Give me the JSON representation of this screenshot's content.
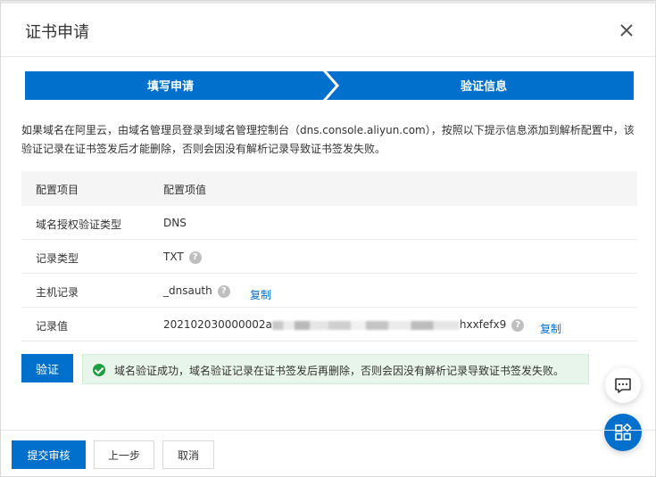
{
  "dialog": {
    "title": "证书申请"
  },
  "steps": [
    {
      "label": "填写申请"
    },
    {
      "label": "验证信息"
    }
  ],
  "info": {
    "text": "如果域名在阿里云，由域名管理员登录到域名管理控制台（dns.console.aliyun.com），按照以下提示信息添加到解析配置中，该验证记录在证书签发后才能删除，否则会因没有解析记录导致证书签发失败。"
  },
  "table": {
    "headers": {
      "key": "配置项目",
      "value": "配置项值"
    },
    "rows": [
      {
        "key": "域名授权验证类型",
        "value": "DNS"
      },
      {
        "key": "记录类型",
        "value": "TXT"
      },
      {
        "key": "主机记录",
        "value": "_dnsauth",
        "action": "复制"
      },
      {
        "key": "记录值",
        "value_prefix": "202102030000002a",
        "value_suffix": "hxxfefx9",
        "action": "复制"
      }
    ]
  },
  "verify": {
    "button_label": "验证"
  },
  "success": {
    "text": "域名验证成功，域名验证记录在证书签发后再删除，否则会因没有解析记录导致证书签发失败。"
  },
  "footer": {
    "submit": "提交审核",
    "prev": "上一步",
    "cancel": "取消"
  },
  "colors": {
    "primary": "#0070cc",
    "success": "#1e9e3e",
    "success_bg": "#e8f5ea"
  },
  "icons": {
    "close": "close-icon",
    "help": "question-circle-icon",
    "check": "check-circle-icon",
    "chat": "chat-icon",
    "apps": "apps-icon"
  }
}
